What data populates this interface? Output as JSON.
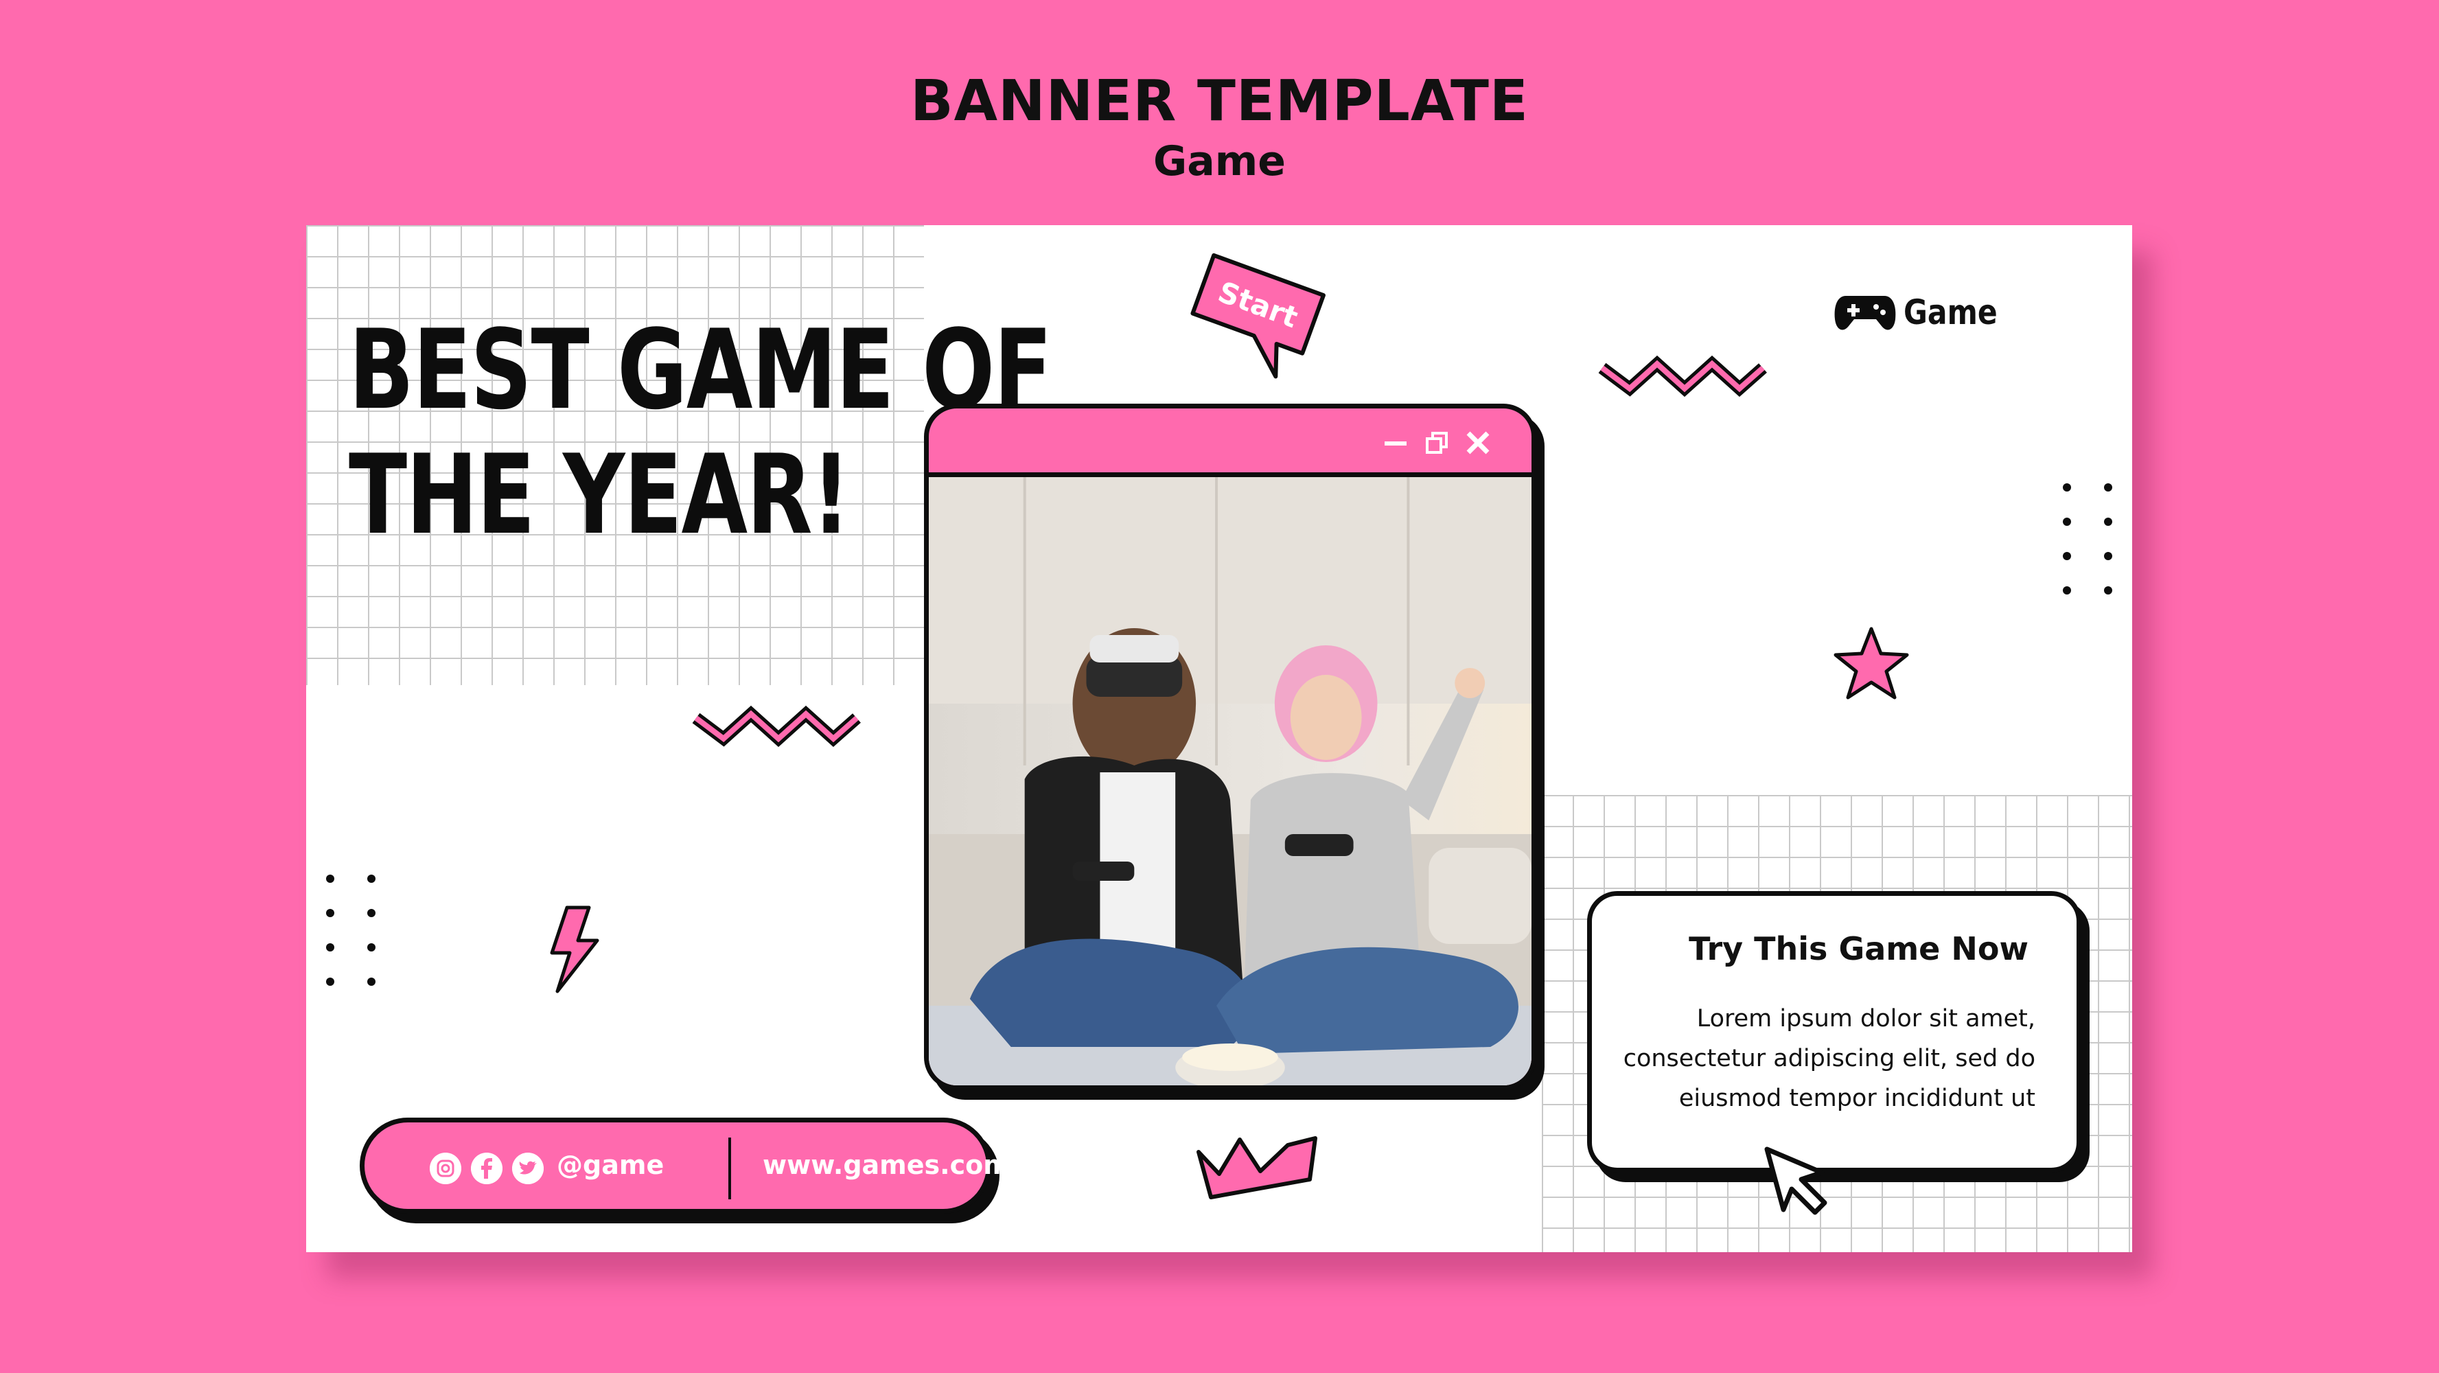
{
  "header": {
    "title": "BANNER TEMPLATE",
    "subtitle": "Game"
  },
  "banner": {
    "headline_line1": "BEST GAME OF",
    "headline_line2": "THE YEAR!",
    "start_tag": "Start",
    "brand_label": "Game",
    "window_controls": [
      "minimize-icon",
      "restore-icon",
      "close-icon"
    ],
    "social": {
      "icons": [
        "instagram-icon",
        "facebook-icon",
        "twitter-icon"
      ],
      "handle": "@game",
      "website": "www.games.com"
    },
    "card": {
      "title": "Try This Game Now",
      "body_line1": "Lorem ipsum dolor sit amet,",
      "body_line2": "consectetur adipiscing elit, sed do",
      "body_line3": "eiusmod tempor incididunt ut"
    }
  },
  "colors": {
    "background": "#ff6aae",
    "accent": "#ff6aae",
    "ink": "#0d0d0d",
    "paper": "#ffffff"
  }
}
